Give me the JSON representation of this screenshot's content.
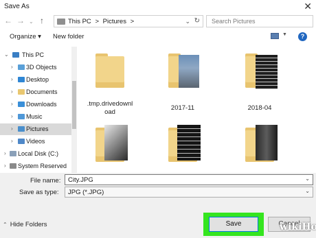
{
  "window": {
    "title": "Save As"
  },
  "address": {
    "breadcrumb": [
      "This PC",
      ">",
      "Pictures",
      ">"
    ],
    "search_placeholder": "Search Pictures"
  },
  "toolbar": {
    "organize": "Organize ▾",
    "new_folder": "New folder",
    "help": "?"
  },
  "sidebar": {
    "items": [
      {
        "label": "This PC",
        "icon": "computer-icon"
      },
      {
        "label": "3D Objects",
        "icon": "cube-folder-icon"
      },
      {
        "label": "Desktop",
        "icon": "desktop-folder-icon"
      },
      {
        "label": "Documents",
        "icon": "documents-folder-icon"
      },
      {
        "label": "Downloads",
        "icon": "downloads-folder-icon"
      },
      {
        "label": "Music",
        "icon": "music-folder-icon"
      },
      {
        "label": "Pictures",
        "icon": "pictures-folder-icon",
        "selected": true
      },
      {
        "label": "Videos",
        "icon": "videos-folder-icon"
      },
      {
        "label": "Local Disk (C:)",
        "icon": "drive-icon"
      },
      {
        "label": "System Reserved",
        "icon": "drive-icon"
      }
    ]
  },
  "folders": [
    {
      "name": ".tmp.drivedownl",
      "name2": "oad",
      "icon": "empty-folder-icon"
    },
    {
      "name": "2017-11",
      "icon": "photo-folder-icon"
    },
    {
      "name": "2018-04",
      "icon": "photo-folder-icon"
    },
    {
      "name": "",
      "icon": "photo-folder-icon"
    },
    {
      "name": "",
      "icon": "photo-folder-icon"
    },
    {
      "name": "",
      "icon": "photo-folder-icon"
    }
  ],
  "form": {
    "file_name_label": "File name:",
    "file_name_value": "City.JPG",
    "save_type_label": "Save as type:",
    "save_type_value": "JPG (*.JPG)"
  },
  "footer": {
    "hide_folders": "Hide Folders",
    "save": "Save",
    "cancel": "Cancel"
  },
  "watermark": "wikiHow",
  "colors": {
    "highlight": "#35e51f",
    "folder": "#f2d58b",
    "accent": "#0078d7"
  }
}
